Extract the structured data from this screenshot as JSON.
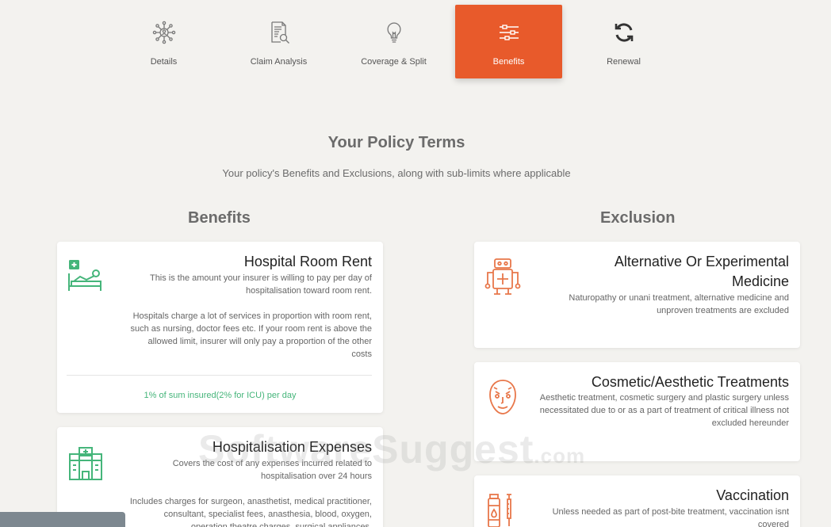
{
  "tabs": [
    {
      "label": "Details",
      "icon": "network-user-icon"
    },
    {
      "label": "Claim Analysis",
      "icon": "document-search-icon"
    },
    {
      "label": "Coverage & Split",
      "icon": "lightbulb-icon"
    },
    {
      "label": "Benefits",
      "icon": "sliders-icon",
      "active": true
    },
    {
      "label": "Renewal",
      "icon": "refresh-icon"
    }
  ],
  "page": {
    "title": "Your Policy Terms",
    "subtitle": "Your policy's Benefits and Exclusions, along with sub-limits where applicable"
  },
  "benefits": {
    "heading": "Benefits",
    "cards": [
      {
        "title": "Hospital Room Rent",
        "text1": "This is the amount your insurer is willing to pay per day of hospitalisation toward room rent.",
        "text2": "Hospitals charge a lot of services in proportion with room rent, such as nursing, doctor fees etc. If your room rent is above the allowed limit, insurer will only pay a proportion of the other costs",
        "limit": "1% of sum insured(2% for ICU) per day",
        "icon": "hospital-bed-icon"
      },
      {
        "title": "Hospitalisation Expenses",
        "text1": "Covers the cost of any expenses incurred related to hospitalisation over 24 hours",
        "text2": "Includes charges for surgeon, anasthetist, medical practitioner, consultant, specialist fees, anasthesia, blood, oxygen, operation theatre charges, surgical appliances,",
        "icon": "hospital-building-icon"
      }
    ]
  },
  "exclusion": {
    "heading": "Exclusion",
    "cards": [
      {
        "title": "Alternative Or Experimental Medicine",
        "text": "Naturopathy or unani treatment, alternative medicine and unproven treatments are excluded",
        "icon": "robot-medicine-icon"
      },
      {
        "title": "Cosmetic/Aesthetic Treatments",
        "text": "Aesthetic treatment, cosmetic surgery and plastic surgery unless necessitated due to or as a part of treatment of critical illness not excluded hereunder",
        "icon": "face-icon"
      },
      {
        "title": "Vaccination",
        "text": "Unless needed as part of post-bite treatment, vaccination isnt covered",
        "icon": "vaccine-icon"
      }
    ]
  },
  "watermark": {
    "main": "SoftwareSuggest",
    "suffix": ".com"
  },
  "colors": {
    "accent": "#e85a2b",
    "green": "#45b57a",
    "orange_icon": "#e8774a"
  }
}
